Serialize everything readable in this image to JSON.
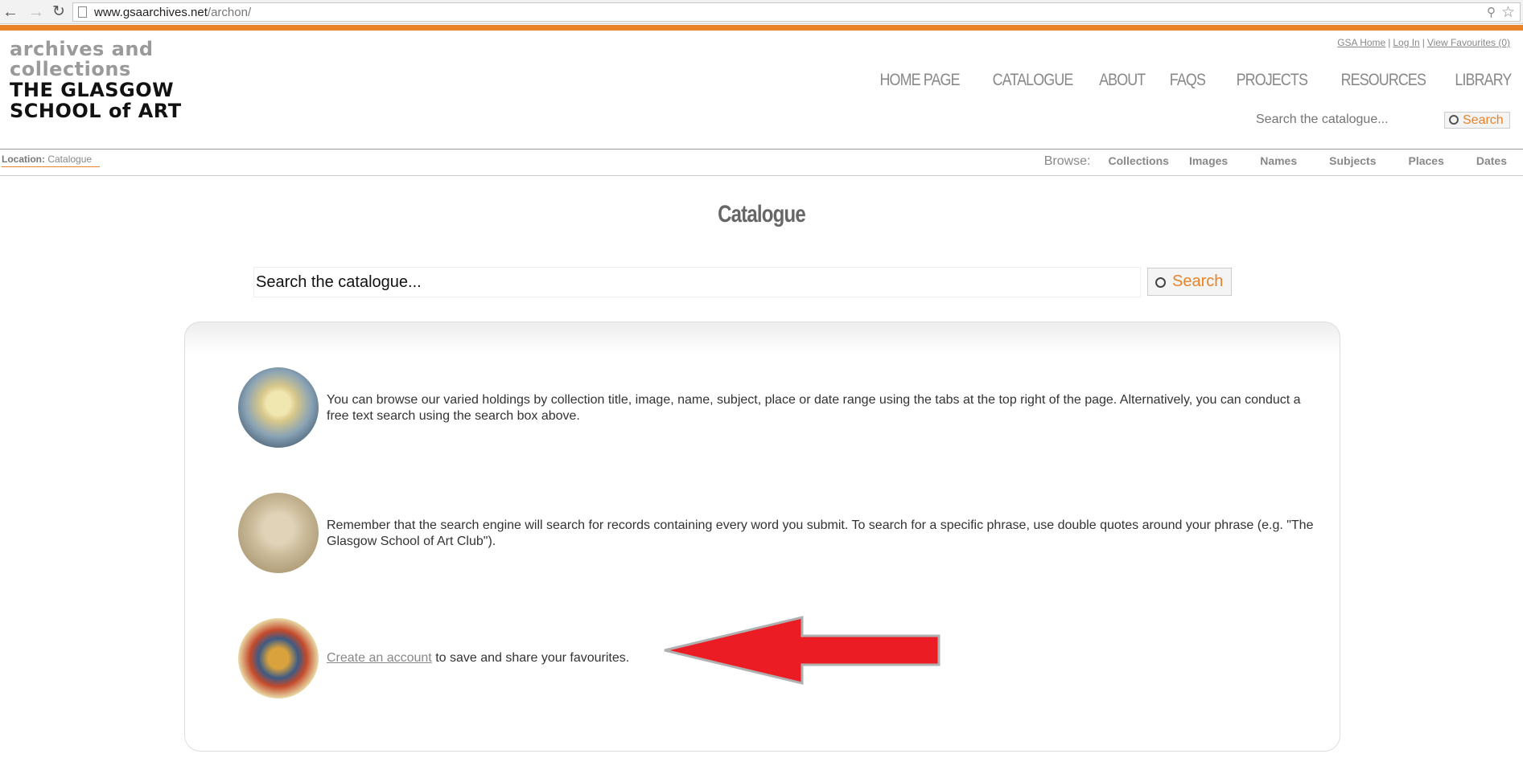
{
  "browser": {
    "url_host": "www.gsaarchives.net",
    "url_path": "/archon/"
  },
  "logo": {
    "line1": "ARCHIVES and",
    "line2": "COLLECTIONS",
    "line3": "THE GLASGOW",
    "line4": "SCHOOL of ART"
  },
  "top_links": {
    "home": "GSA Home",
    "login": "Log In",
    "favourites": "View Favourites (0)",
    "separator": "|"
  },
  "main_nav": [
    "HOME PAGE",
    "CATALOGUE",
    "ABOUT",
    "FAQS",
    "PROJECTS",
    "RESOURCES",
    "LIBRARY"
  ],
  "header_search": {
    "placeholder": "Search the catalogue...",
    "button": "Search"
  },
  "location": {
    "label": "Location:",
    "value": "Catalogue"
  },
  "browse": {
    "label": "Browse:",
    "items": [
      "Collections",
      "Images",
      "Names",
      "Subjects",
      "Places",
      "Dates"
    ]
  },
  "page_title": "Catalogue",
  "main_search": {
    "value": "Search the catalogue...",
    "button": "Search"
  },
  "items": [
    {
      "text": "You can browse our varied holdings by collection title, image, name, subject, place or date range using the tabs at the top right of the page. Alternatively, you can conduct a free text search using the search box above."
    },
    {
      "text": "Remember that the search engine will search for records containing every word you submit. To search for a specific phrase, use double quotes around your phrase (e.g. \"The Glasgow School of Art Club\")."
    },
    {
      "link": "Create an account",
      "text": " to save and share your favourites."
    }
  ],
  "colors": {
    "accent": "#e8832a",
    "arrow": "#ec1c24"
  }
}
